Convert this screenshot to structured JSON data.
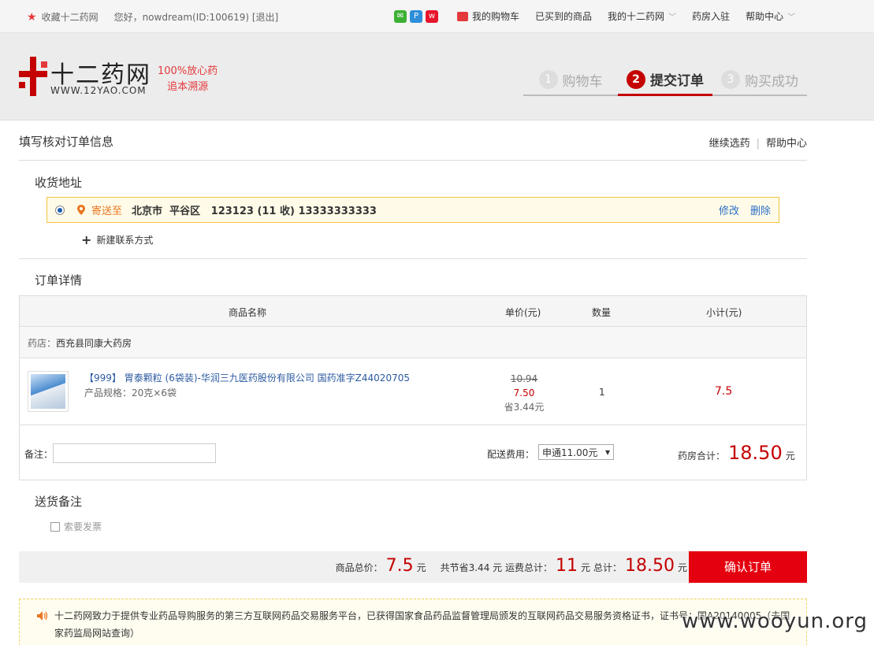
{
  "topbar": {
    "favorite": "收藏十二药网",
    "greeting": "您好，nowdream(ID:100619) [退出]",
    "cart": "我的购物车",
    "bought": "已买到的商品",
    "my_site": "我的十二药网",
    "pharmacy_join": "药房入驻",
    "help": "帮助中心"
  },
  "header": {
    "logo_title": "十二药网",
    "logo_url": "WWW.12YAO.COM",
    "slogan_1": "100%放心药",
    "slogan_2": "追本溯源",
    "steps": [
      {
        "num": "1",
        "label": "购物车"
      },
      {
        "num": "2",
        "label": "提交订单"
      },
      {
        "num": "3",
        "label": "购买成功"
      }
    ],
    "active_step": 2
  },
  "page": {
    "title": "填写核对订单信息",
    "continue_link": "继续选药",
    "help_link": "帮助中心"
  },
  "address": {
    "heading": "收货地址",
    "send_to": "寄送至",
    "text": "北京市  平谷区   123123 (11 收) 13333333333",
    "edit": "修改",
    "delete": "删除",
    "new_contact": "新建联系方式"
  },
  "order": {
    "heading": "订单详情",
    "columns": {
      "name": "商品名称",
      "unit_price": "单价(元)",
      "qty": "数量",
      "subtotal": "小计(元)"
    },
    "store_label": "药店：",
    "store_name": "西充县同康大药房",
    "item": {
      "name": "【999】 胃泰颗粒 (6袋装)-华润三九医药股份有限公司 国药准字Z44020705",
      "spec": "产品规格：20克×6袋",
      "old_price": "10.94",
      "price": "7.50",
      "saved": "省3.44元",
      "qty": "1",
      "subtotal": "7.5"
    },
    "remark_label": "备注：",
    "shipping_label": "配送费用：",
    "shipping_option": "申通11.00元",
    "store_total_label": "药房合计：",
    "store_total": "18.50",
    "store_total_unit": "元"
  },
  "delivery": {
    "heading": "送货备注",
    "invoice": "索要发票"
  },
  "summary": {
    "goods_label": "商品总价：",
    "goods_total": "7.5",
    "unit": "元",
    "saved_text": "共节省3.44 元 运费总计：",
    "shipping_total": "11",
    "total_label": "总计：",
    "total": "18.50",
    "confirm": "确认订单"
  },
  "notice": "十二药网致力于提供专业药品导购服务的第三方互联网药品交易服务平台，已获得国家食品药品监督管理局颁发的互联网药品交易服务资格证书，证书号：国A20140005（去国家药监局网站查询）",
  "watermark": "www.wooyun.org",
  "colors": {
    "brand_red": "#e4393c",
    "active_step": "#c40000",
    "link_blue": "#2c6fc6",
    "button_red": "#e4000f"
  }
}
